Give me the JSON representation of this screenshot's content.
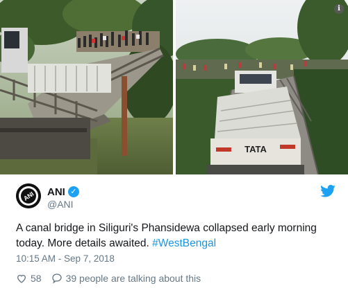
{
  "media": {
    "info_glyph": "i"
  },
  "author": {
    "name": "ANI",
    "handle": "@ANI",
    "avatar_text": "ANI",
    "verified_glyph": "✓"
  },
  "tweet": {
    "text": "A canal bridge in Siliguri's Phansidewa collapsed early morning today. More details awaited. ",
    "hashtag": "#WestBengal",
    "timestamp": "10:15 AM - Sep 7, 2018"
  },
  "actions": {
    "likes": "58",
    "talking": "39 people are talking about this"
  },
  "truck": {
    "brand": "TATA"
  },
  "colors": {
    "accent": "#1da1f2",
    "link": "#1b95e0",
    "secondary_text": "#657786"
  }
}
